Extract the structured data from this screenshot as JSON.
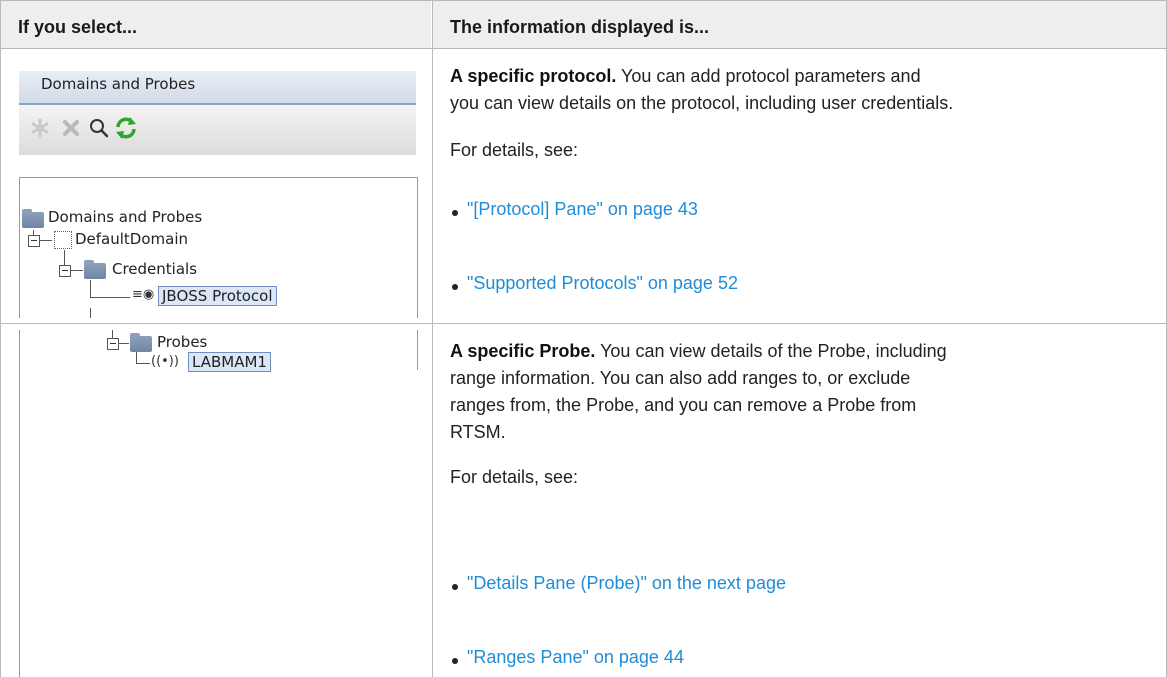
{
  "header": {
    "col1": "If you select...",
    "col2": "The information displayed is..."
  },
  "row1": {
    "shot": {
      "title": "Domains and Probes",
      "toolbar_icons": [
        "asterisk-icon",
        "delete-x-icon",
        "search-icon",
        "refresh-icon"
      ],
      "tree": {
        "root": "Domains and Probes",
        "domain": "DefaultDomain",
        "credentials": "Credentials",
        "protocol": "JBOSS Protocol"
      }
    },
    "lead": "A specific protocol.",
    "desc_l1": " You can add protocol parameters and",
    "desc_l2": "you can view details on the protocol, including user credentials.",
    "for_details": "For details, see:",
    "links": [
      "\"[Protocol] Pane\" on page 43",
      "\"Supported Protocols\" on page 52"
    ]
  },
  "row2": {
    "shot": {
      "probes": "Probes",
      "probe": "LABMAM1"
    },
    "lead": "A specific Probe.",
    "desc_l1": " You can view details of the Probe, including",
    "desc_l2": "range information. You can also add ranges to, or exclude",
    "desc_l3": "ranges from, the Probe, and you can remove a Probe from",
    "desc_l4": "RTSM.",
    "for_details": "For details, see:",
    "links": [
      "\"Details Pane (Probe)\" on the next page",
      "\"Ranges Pane\" on page 44"
    ]
  },
  "colors": {
    "link": "#1f8dd6",
    "header_bg": "#eeeeee",
    "border": "#b8b8b8"
  }
}
